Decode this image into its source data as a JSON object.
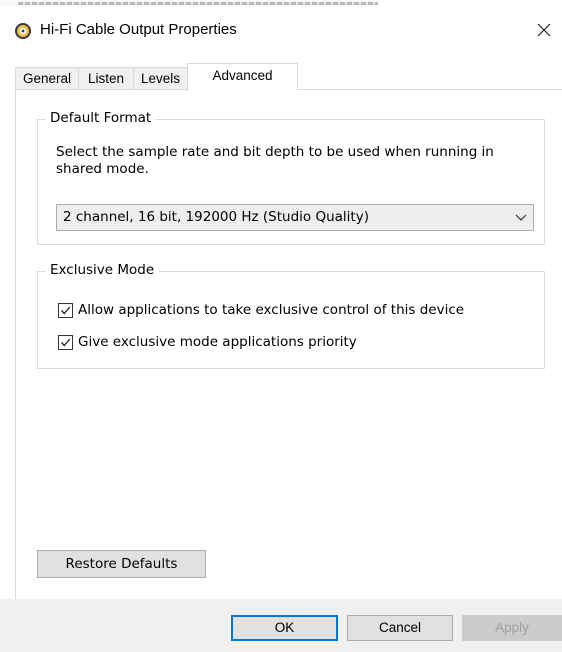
{
  "window": {
    "title": "Hi-Fi Cable Output Properties",
    "icon": "speaker-icon",
    "close_glyph": "✕"
  },
  "tabs": [
    {
      "label": "General",
      "active": false
    },
    {
      "label": "Listen",
      "active": false
    },
    {
      "label": "Levels",
      "active": false
    },
    {
      "label": "Advanced",
      "active": true
    }
  ],
  "default_format": {
    "legend": "Default Format",
    "description": "Select the sample rate and bit depth to be used when running in shared mode.",
    "selected_value": "2 channel, 16 bit, 192000 Hz (Studio Quality)"
  },
  "exclusive_mode": {
    "legend": "Exclusive Mode",
    "options": [
      {
        "label": "Allow applications to take exclusive control of this device",
        "checked": true
      },
      {
        "label": "Give exclusive mode applications priority",
        "checked": true
      }
    ]
  },
  "buttons": {
    "restore_defaults": "Restore Defaults",
    "ok": "OK",
    "cancel": "Cancel",
    "apply": "Apply"
  },
  "colors": {
    "accent": "#0078d7",
    "footer_bg": "#f0f0f0",
    "disabled_text": "#a0a0a0"
  }
}
